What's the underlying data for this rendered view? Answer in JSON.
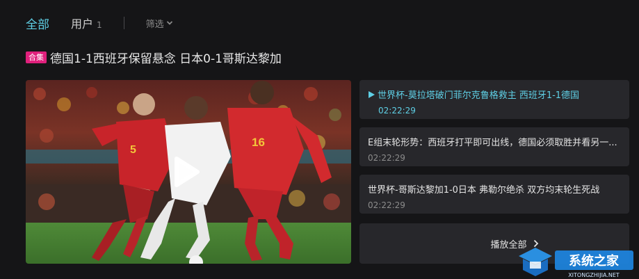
{
  "tabs": {
    "all": "全部",
    "users": "用户",
    "users_count": "1",
    "filter": "筛选"
  },
  "header": {
    "badge": "合集",
    "title": "德国1-1西班牙保留悬念 日本0-1哥斯达黎加"
  },
  "video": {
    "jersey_numbers": [
      "5",
      "16"
    ]
  },
  "playlist": [
    {
      "title": "世界杯-莫拉塔破门菲尔克鲁格救主 西班牙1-1德国",
      "time": "02:22:29",
      "active": true
    },
    {
      "title": "E组末轮形势：西班牙打平即可出线，德国必须取胜并看另一...",
      "time": "02:22:29",
      "active": false
    },
    {
      "title": "世界杯-哥斯达黎加1-0日本 弗勒尔绝杀 双方均末轮生死战",
      "time": "02:22:29",
      "active": false
    }
  ],
  "play_all": "播放全部",
  "watermark": {
    "brand": "系统之家",
    "url": "XITONGZHIJIA.NET"
  },
  "colors": {
    "accent": "#5fd0e6",
    "badge": "#e0207c",
    "background": "#151517",
    "card": "#27272b"
  }
}
